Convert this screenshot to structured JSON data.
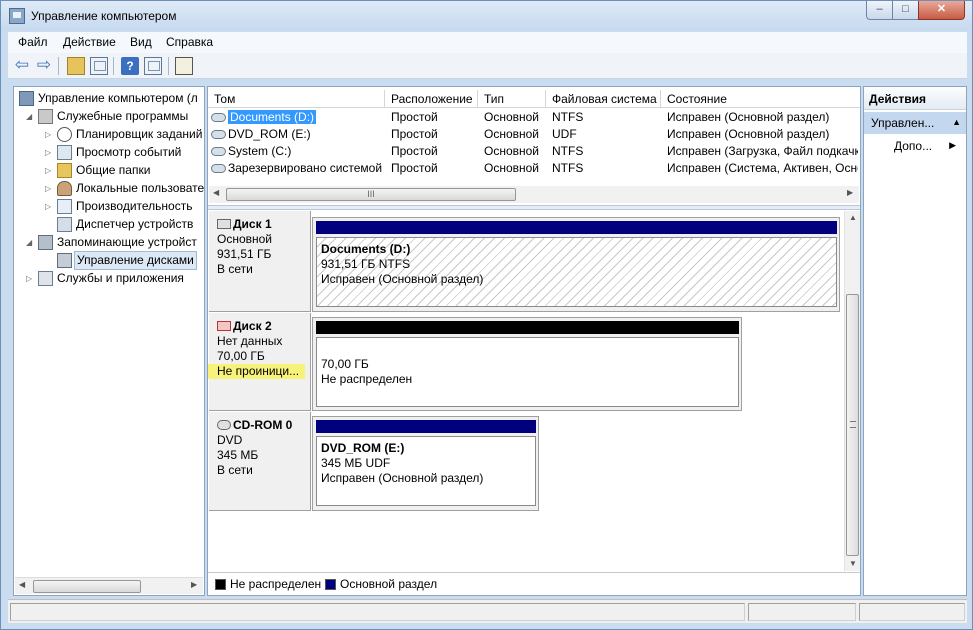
{
  "window": {
    "title": "Управление компьютером",
    "min": "–",
    "max": "□",
    "close": "✕"
  },
  "menu": [
    "Файл",
    "Действие",
    "Вид",
    "Справка"
  ],
  "toolbar": {
    "back": "⇦",
    "forward": "⇨",
    "help": "?"
  },
  "tree": [
    {
      "label": "Управление компьютером (л",
      "icon": "computer-icon",
      "level": 0
    },
    {
      "label": "Служебные программы",
      "icon": "tools-icon",
      "level": 1,
      "expander": "◢"
    },
    {
      "label": "Планировщик заданий",
      "icon": "clock-icon",
      "level": 2,
      "expander": "▷"
    },
    {
      "label": "Просмотр событий",
      "icon": "event-viewer-icon",
      "level": 2,
      "expander": "▷"
    },
    {
      "label": "Общие папки",
      "icon": "shared-folder-icon",
      "level": 2,
      "expander": "▷"
    },
    {
      "label": "Локальные пользовате",
      "icon": "users-icon",
      "level": 2,
      "expander": "▷"
    },
    {
      "label": "Производительность",
      "icon": "performance-icon",
      "level": 2,
      "expander": "▷"
    },
    {
      "label": "Диспетчер устройств",
      "icon": "device-manager-icon",
      "level": 2
    },
    {
      "label": "Запоминающие устройст",
      "icon": "storage-icon",
      "level": 1,
      "expander": "◢"
    },
    {
      "label": "Управление дисками",
      "icon": "disk-management-icon",
      "level": 2,
      "selected": true
    },
    {
      "label": "Службы и приложения",
      "icon": "services-icon",
      "level": 1,
      "expander": "▷"
    }
  ],
  "volumes": {
    "columns": [
      "Том",
      "Расположение",
      "Тип",
      "Файловая система",
      "Состояние"
    ],
    "rows": [
      [
        "Documents (D:)",
        "Простой",
        "Основной",
        "NTFS",
        "Исправен (Основной раздел)"
      ],
      [
        "DVD_ROM (E:)",
        "Простой",
        "Основной",
        "UDF",
        "Исправен (Основной раздел)"
      ],
      [
        "System (C:)",
        "Простой",
        "Основной",
        "NTFS",
        "Исправен (Загрузка, Файл подкачки"
      ],
      [
        "Зарезервировано системой",
        "Простой",
        "Основной",
        "NTFS",
        "Исправен (Система, Активен, Осно"
      ]
    ],
    "hscroll_grip": "III"
  },
  "disks": [
    {
      "name": "Диск 1",
      "lines": [
        "Основной",
        "931,51 ГБ",
        "В сети"
      ],
      "partition": {
        "title": "Documents  (D:)",
        "size": "931,51 ГБ NTFS",
        "status": "Исправен (Основной раздел)",
        "bar_color": "#00007f"
      }
    },
    {
      "name": "Диск 2",
      "lines": [
        "Нет данных",
        "70,00 ГБ",
        "Не проиници..."
      ],
      "partition": {
        "title": "",
        "size": "70,00 ГБ",
        "status": "Не распределен",
        "bar_color": "#000000"
      }
    },
    {
      "name": "CD-ROM 0",
      "lines": [
        "DVD",
        "345 МБ",
        "В сети"
      ],
      "partition": {
        "title": "DVD_ROM  (E:)",
        "size": "345 МБ UDF",
        "status": "Исправен (Основной раздел)",
        "bar_color": "#00007f"
      }
    }
  ],
  "legend": [
    {
      "label": "Не распределен",
      "color": "#000000"
    },
    {
      "label": "Основной раздел",
      "color": "#00007f"
    }
  ],
  "actions": {
    "header": "Действия",
    "section": "Управлен...",
    "item": "Допо..."
  }
}
